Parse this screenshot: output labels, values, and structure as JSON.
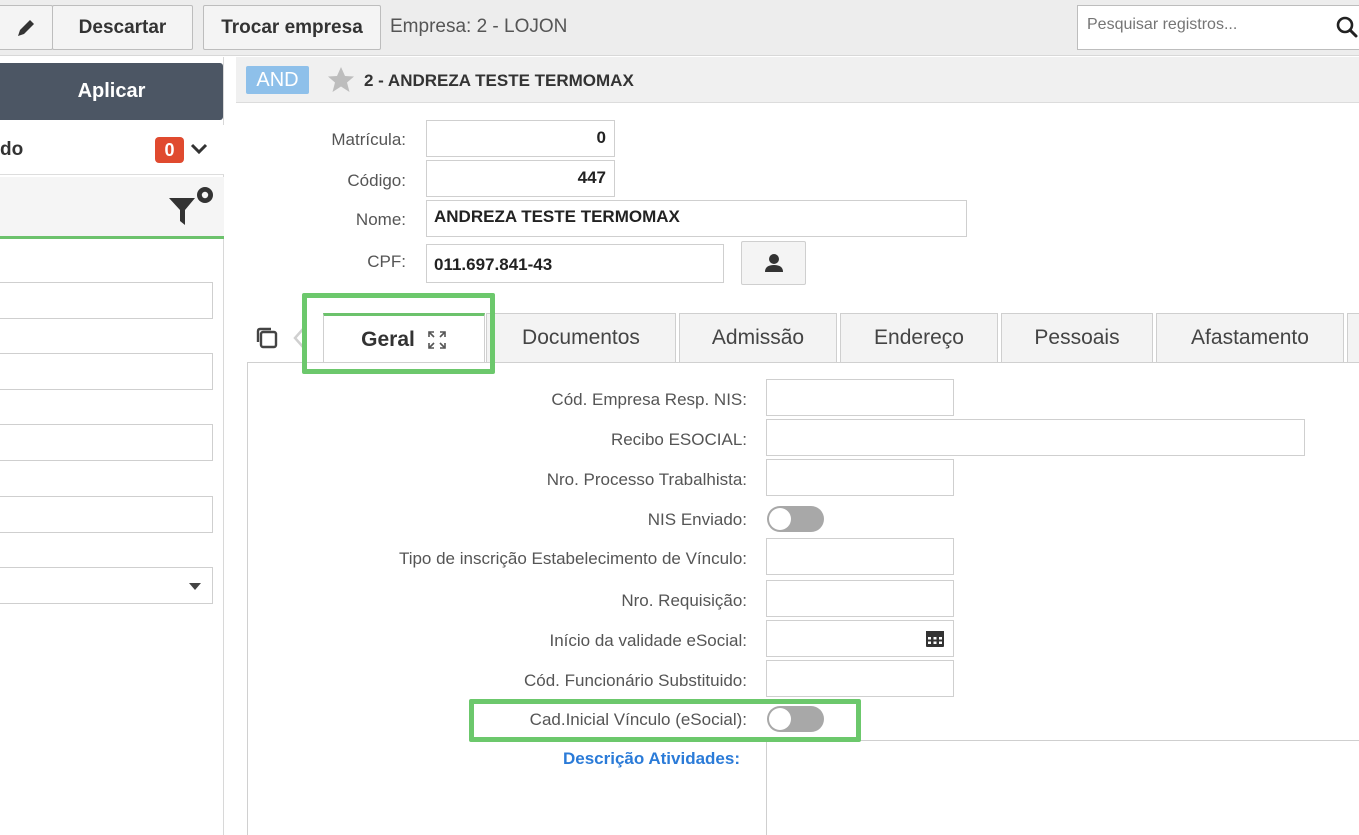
{
  "toolbar": {
    "descartar_label": "Descartar",
    "trocar_label": "Trocar empresa",
    "empresa_label": "Empresa: 2 - LOJON",
    "search_placeholder": "Pesquisar registros..."
  },
  "left_panel": {
    "aplicar_label": "Aplicar",
    "filter_row_text": "do",
    "filter_count": "0"
  },
  "record": {
    "tag": "AND",
    "title": "2 - ANDREZA TESTE TERMOMAX"
  },
  "form": {
    "matricula_label": "Matrícula:",
    "matricula_value": "0",
    "codigo_label": "Código:",
    "codigo_value": "447",
    "nome_label": "Nome:",
    "nome_value": "ANDREZA TESTE TERMOMAX",
    "cpf_label": "CPF:",
    "cpf_value": "011.697.841-43"
  },
  "tabs": [
    {
      "label": "Geral"
    },
    {
      "label": "Documentos"
    },
    {
      "label": "Admissão"
    },
    {
      "label": "Endereço"
    },
    {
      "label": "Pessoais"
    },
    {
      "label": "Afastamento"
    }
  ],
  "geral": {
    "cod_empresa_label": "Cód. Empresa Resp. NIS:",
    "recibo_label": "Recibo ESOCIAL:",
    "processo_label": "Nro. Processo Trabalhista:",
    "nis_enviado_label": "NIS Enviado:",
    "tipo_inscricao_label": "Tipo de inscrição Estabelecimento de Vínculo:",
    "requisicao_label": "Nro. Requisição:",
    "inicio_validade_label": "Início da validade eSocial:",
    "cod_funcionario_label": "Cód. Funcionário Substituido:",
    "cad_inicial_label": "Cad.Inicial Vínculo (eSocial):",
    "descricao_label": "Descrição Atividades:"
  },
  "colors": {
    "accent_green": "#6cc26c",
    "highlight_green": "#6cc86c",
    "badge_red": "#e04a2f",
    "aplicar_bg": "#4c5664",
    "link_blue": "#2b7bd8"
  }
}
